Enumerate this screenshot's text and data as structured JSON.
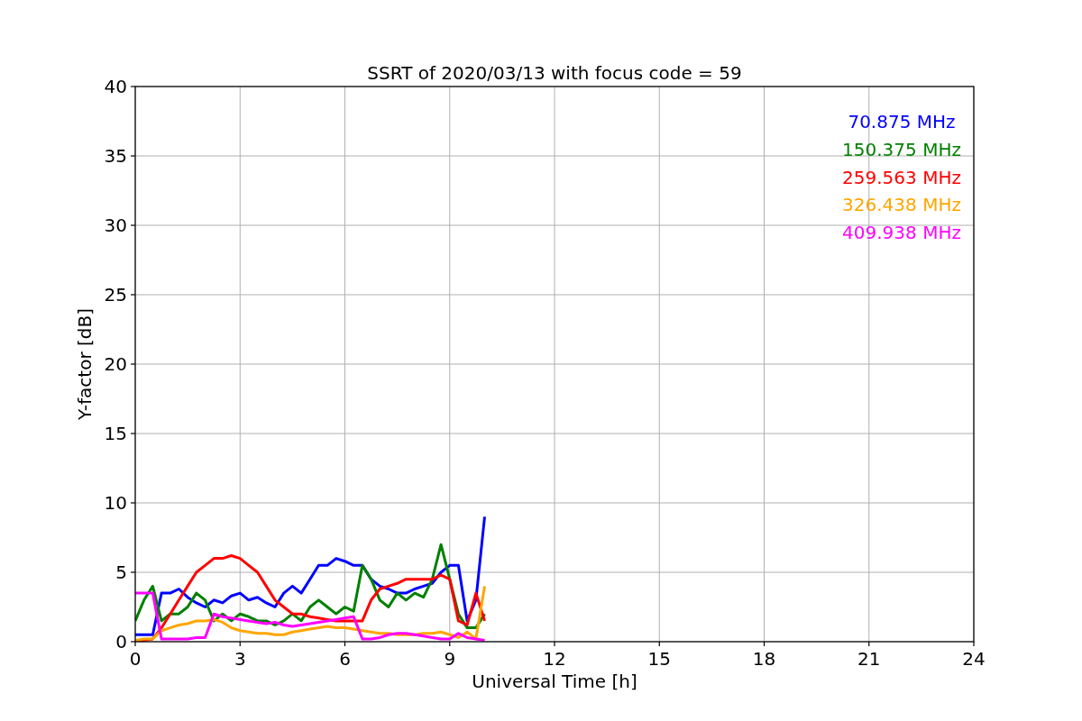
{
  "chart_data": {
    "type": "line",
    "title": "SSRT of 2020/03/13 with focus code = 59",
    "xlabel": "Universal Time [h]",
    "ylabel": "Y-factor [dB]",
    "x": [
      0,
      0.25,
      0.5,
      0.75,
      1,
      1.25,
      1.5,
      1.75,
      2,
      2.25,
      2.5,
      2.75,
      3,
      3.25,
      3.5,
      3.75,
      4,
      4.25,
      4.5,
      4.75,
      5,
      5.25,
      5.5,
      5.75,
      6,
      6.25,
      6.5,
      6.75,
      7,
      7.25,
      7.5,
      7.75,
      8,
      8.25,
      8.5,
      8.75,
      9,
      9.25,
      9.5,
      9.75,
      10
    ],
    "series": [
      {
        "name": "70.875 MHz",
        "color": "#0000ff",
        "values": [
          0.5,
          0.5,
          0.5,
          3.5,
          3.5,
          3.8,
          3.2,
          2.8,
          2.5,
          3.0,
          2.8,
          3.3,
          3.5,
          3.0,
          3.2,
          2.8,
          2.5,
          3.5,
          4.0,
          3.5,
          4.5,
          5.5,
          5.5,
          6.0,
          5.8,
          5.5,
          5.5,
          4.5,
          4.0,
          3.8,
          3.5,
          3.5,
          3.8,
          4.0,
          4.2,
          5.0,
          5.5,
          5.5,
          1.5,
          3.0,
          9.0
        ]
      },
      {
        "name": "150.375 MHz",
        "color": "#008000",
        "values": [
          1.5,
          3.0,
          4.0,
          1.5,
          2.0,
          2.0,
          2.5,
          3.5,
          3.0,
          1.5,
          2.0,
          1.5,
          2.0,
          1.8,
          1.5,
          1.5,
          1.2,
          1.5,
          2.0,
          1.5,
          2.5,
          3.0,
          2.5,
          2.0,
          2.5,
          2.2,
          5.5,
          4.5,
          3.0,
          2.5,
          3.5,
          3.0,
          3.5,
          3.2,
          4.5,
          7.0,
          4.5,
          2.0,
          1.0,
          1.0,
          2.0
        ]
      },
      {
        "name": "259.563 MHz",
        "color": "#ff0000",
        "values": [
          0.1,
          0.1,
          0.2,
          1.0,
          2.0,
          3.0,
          4.0,
          5.0,
          5.5,
          6.0,
          6.0,
          6.2,
          6.0,
          5.5,
          5.0,
          4.0,
          3.0,
          2.5,
          2.0,
          2.0,
          1.8,
          1.7,
          1.6,
          1.5,
          1.5,
          1.5,
          1.5,
          3.0,
          3.8,
          4.0,
          4.2,
          4.5,
          4.5,
          4.5,
          4.5,
          4.8,
          4.5,
          1.5,
          1.2,
          3.5,
          1.5
        ]
      },
      {
        "name": "326.438 MHz",
        "color": "#ffa500",
        "values": [
          0.1,
          0.2,
          0.2,
          0.8,
          1.0,
          1.2,
          1.3,
          1.5,
          1.5,
          1.6,
          1.4,
          1.0,
          0.8,
          0.7,
          0.6,
          0.6,
          0.5,
          0.5,
          0.7,
          0.8,
          0.9,
          1.0,
          1.1,
          1.0,
          1.0,
          0.9,
          0.8,
          0.7,
          0.6,
          0.6,
          0.5,
          0.5,
          0.5,
          0.6,
          0.6,
          0.7,
          0.5,
          0.3,
          0.7,
          0.2,
          4.0
        ]
      },
      {
        "name": "409.938 MHz",
        "color": "#ff00ff",
        "values": [
          3.5,
          3.5,
          3.5,
          0.2,
          0.2,
          0.2,
          0.2,
          0.3,
          0.3,
          2.0,
          1.8,
          1.7,
          1.6,
          1.5,
          1.4,
          1.3,
          1.4,
          1.2,
          1.1,
          1.2,
          1.3,
          1.4,
          1.5,
          1.6,
          1.7,
          1.8,
          0.2,
          0.2,
          0.3,
          0.5,
          0.6,
          0.6,
          0.5,
          0.4,
          0.3,
          0.2,
          0.2,
          0.6,
          0.3,
          0.2,
          0.1
        ]
      }
    ],
    "xlim": [
      0,
      24
    ],
    "ylim": [
      0,
      40
    ],
    "xticks": [
      0,
      3,
      6,
      9,
      12,
      15,
      18,
      21,
      24
    ],
    "yticks": [
      0,
      5,
      10,
      15,
      20,
      25,
      30,
      35,
      40
    ],
    "grid": true
  }
}
